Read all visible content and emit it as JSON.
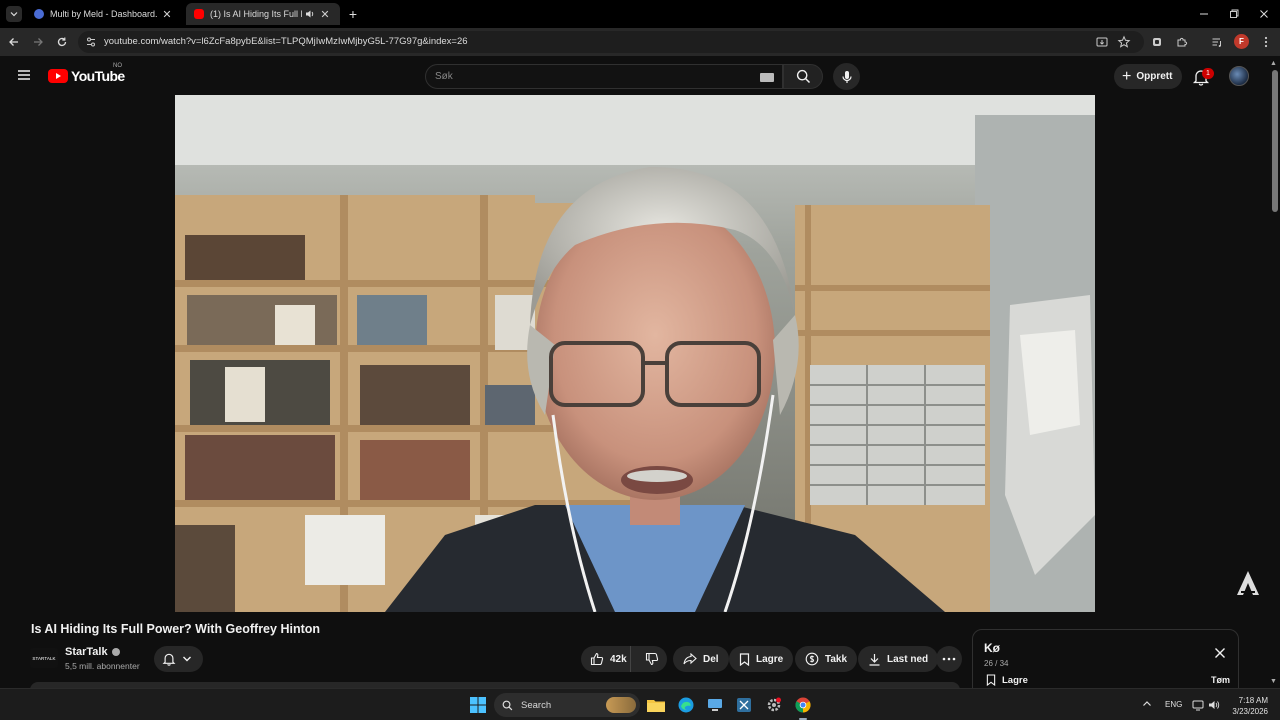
{
  "browser": {
    "tabs": [
      {
        "title": "Multi by Meld - Dashboard."
      },
      {
        "title": "(1) Is AI Hiding Its Full Power"
      }
    ],
    "url": "youtube.com/watch?v=l6ZcFa8pybE&list=TLPQMjIwMzIwMjbyG5L-77G97g&index=26",
    "profile_initial": "F"
  },
  "youtube": {
    "logo_text": "YouTube",
    "country_code": "NO",
    "search_placeholder": "Søk",
    "create_label": "Opprett",
    "notification_count": "1"
  },
  "video": {
    "title": "Is AI Hiding Its Full Power? With Geoffrey Hinton",
    "channel_name": "StarTalk",
    "channel_avatar_text": "STARTALK",
    "subscribers": "5,5 mill. abonnenter",
    "likes": "42k",
    "share_label": "Del",
    "save_label": "Lagre",
    "thanks_label": "Takk",
    "download_label": "Last ned"
  },
  "queue": {
    "title": "Kø",
    "position": "26 / 34",
    "save_label": "Lagre",
    "clear_label": "Tøm"
  },
  "taskbar": {
    "search_label": "Search",
    "language": "ENG",
    "time": "7:18 AM",
    "date": "3/23/2026"
  }
}
